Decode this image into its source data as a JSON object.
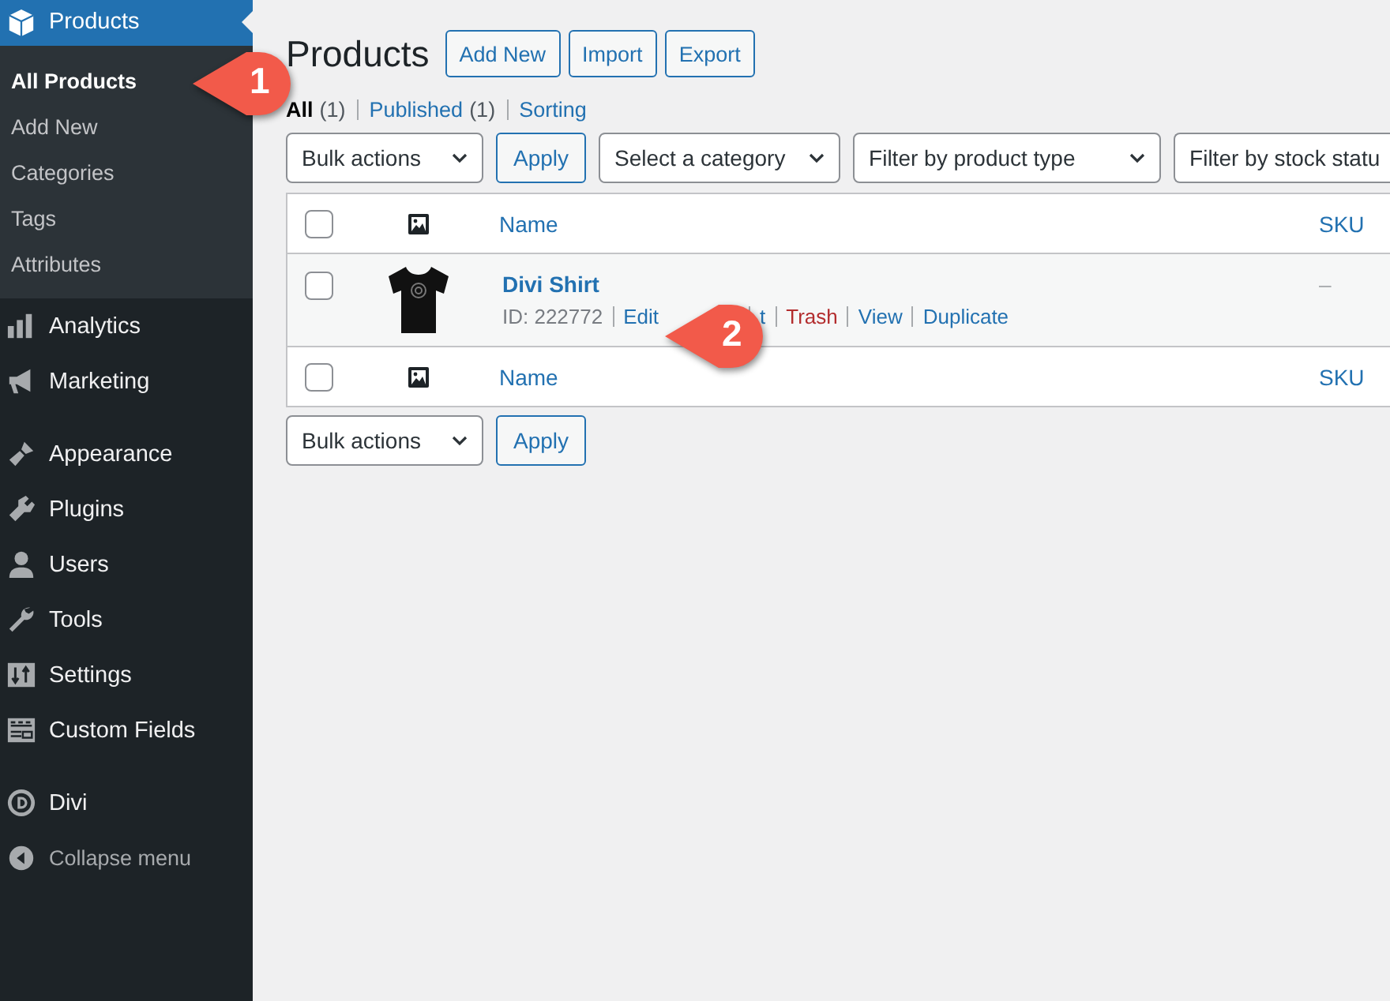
{
  "sidebar": {
    "groups": [
      [
        {
          "label": "Products",
          "current": true,
          "children": [
            {
              "label": "All Products",
              "selected": true
            },
            {
              "label": "Add New",
              "selected": false
            },
            {
              "label": "Categories",
              "selected": false
            },
            {
              "label": "Tags",
              "selected": false
            },
            {
              "label": "Attributes",
              "selected": false
            }
          ]
        },
        {
          "label": "Analytics",
          "current": false
        },
        {
          "label": "Marketing",
          "current": false
        }
      ],
      [
        {
          "label": "Appearance",
          "current": false
        },
        {
          "label": "Plugins",
          "current": false
        },
        {
          "label": "Users",
          "current": false
        },
        {
          "label": "Tools",
          "current": false
        },
        {
          "label": "Settings",
          "current": false
        },
        {
          "label": "Custom Fields",
          "current": false
        }
      ],
      [
        {
          "label": "Divi",
          "current": false
        }
      ]
    ],
    "collapse": "Collapse menu"
  },
  "page": {
    "title": "Products",
    "actions": [
      "Add New",
      "Import",
      "Export"
    ],
    "views": [
      {
        "label": "All",
        "count": "(1)",
        "selected": true
      },
      {
        "label": "Published",
        "count": "(1)",
        "selected": false
      },
      {
        "label": "Sorting",
        "selected": false
      }
    ],
    "top_nav": {
      "bulk": "Bulk actions",
      "apply": "Apply",
      "filters": [
        "Select a category",
        "Filter by product type",
        "Filter by stock statu"
      ]
    },
    "table": {
      "header": [
        {
          "kind": "check",
          "checked": false
        },
        {
          "kind": "thumb"
        },
        {
          "kind": "text",
          "label": "Name"
        },
        {
          "kind": "text",
          "label": "SKU"
        }
      ],
      "rows": [
        {
          "checked": false,
          "name": "Divi Shirt",
          "id": "ID: 222772",
          "actions": [
            {
              "label": "Edit",
              "kind": "link"
            },
            {
              "label": "t",
              "kind": "link"
            },
            {
              "label": "Trash",
              "kind": "danger"
            },
            {
              "label": "View",
              "kind": "link"
            },
            {
              "label": "Duplicate",
              "kind": "link"
            }
          ],
          "sku": "–"
        }
      ],
      "footer": [
        {
          "kind": "check",
          "checked": false
        },
        {
          "kind": "thumb"
        },
        {
          "kind": "text",
          "label": "Name"
        },
        {
          "kind": "text",
          "label": "SKU"
        }
      ]
    },
    "bottom_nav": {
      "bulk": "Bulk actions",
      "apply": "Apply"
    }
  },
  "callouts": [
    {
      "label": "1"
    },
    {
      "label": "2"
    }
  ]
}
